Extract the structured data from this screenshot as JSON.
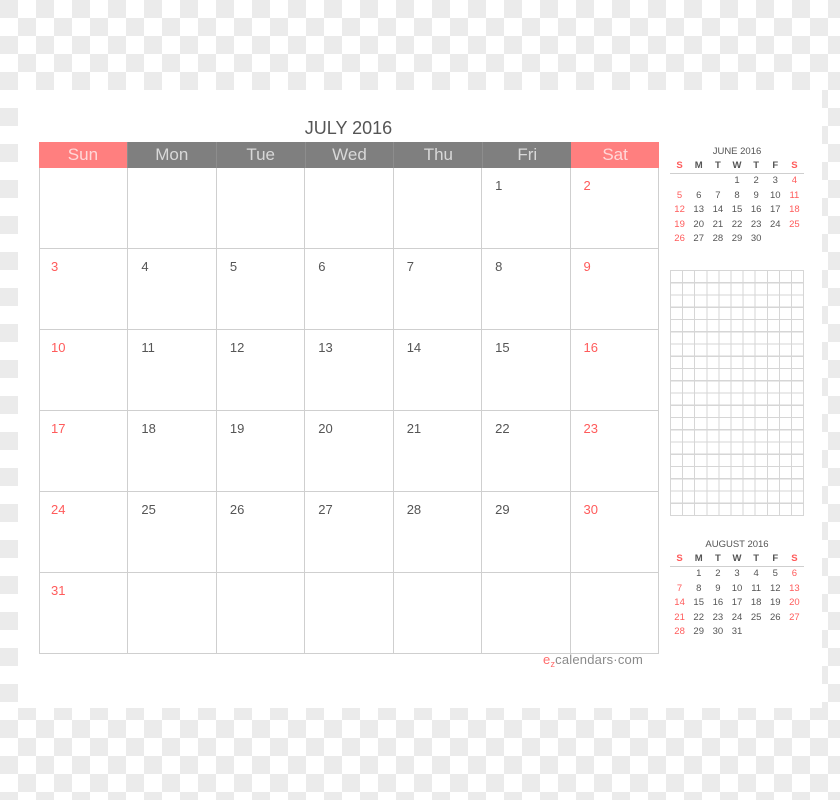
{
  "title": "JULY 2016",
  "weekdays": [
    {
      "label": "Sun",
      "weekend": true
    },
    {
      "label": "Mon",
      "weekend": false
    },
    {
      "label": "Tue",
      "weekend": false
    },
    {
      "label": "Wed",
      "weekend": false
    },
    {
      "label": "Thu",
      "weekend": false
    },
    {
      "label": "Fri",
      "weekend": false
    },
    {
      "label": "Sat",
      "weekend": true
    }
  ],
  "weeks": [
    [
      "",
      "",
      "",
      "",
      "",
      "1",
      "2"
    ],
    [
      "3",
      "4",
      "5",
      "6",
      "7",
      "8",
      "9"
    ],
    [
      "10",
      "11",
      "12",
      "13",
      "14",
      "15",
      "16"
    ],
    [
      "17",
      "18",
      "19",
      "20",
      "21",
      "22",
      "23"
    ],
    [
      "24",
      "25",
      "26",
      "27",
      "28",
      "29",
      "30"
    ],
    [
      "31",
      "",
      "",
      "",
      "",
      "",
      ""
    ]
  ],
  "brand": {
    "e": "e",
    "z": "z",
    "rest": "calendars·com"
  },
  "colors": {
    "accent": "#ff7f7f",
    "weekend_text": "#ff5b5b",
    "header_gray": "#7f7f7f"
  },
  "mini_calendars": [
    {
      "title": "JUNE 2016",
      "weekdays": [
        "S",
        "M",
        "T",
        "W",
        "T",
        "F",
        "S"
      ],
      "weeks": [
        [
          "",
          "",
          "",
          "1",
          "2",
          "3",
          "4"
        ],
        [
          "5",
          "6",
          "7",
          "8",
          "9",
          "10",
          "11"
        ],
        [
          "12",
          "13",
          "14",
          "15",
          "16",
          "17",
          "18"
        ],
        [
          "19",
          "20",
          "21",
          "22",
          "23",
          "24",
          "25"
        ],
        [
          "26",
          "27",
          "28",
          "29",
          "30",
          "",
          ""
        ]
      ]
    },
    {
      "title": "AUGUST 2016",
      "weekdays": [
        "S",
        "M",
        "T",
        "W",
        "T",
        "F",
        "S"
      ],
      "weeks": [
        [
          "",
          "1",
          "2",
          "3",
          "4",
          "5",
          "6"
        ],
        [
          "7",
          "8",
          "9",
          "10",
          "11",
          "12",
          "13"
        ],
        [
          "14",
          "15",
          "16",
          "17",
          "18",
          "19",
          "20"
        ],
        [
          "21",
          "22",
          "23",
          "24",
          "25",
          "26",
          "27"
        ],
        [
          "28",
          "29",
          "30",
          "31",
          "",
          "",
          ""
        ]
      ]
    }
  ]
}
